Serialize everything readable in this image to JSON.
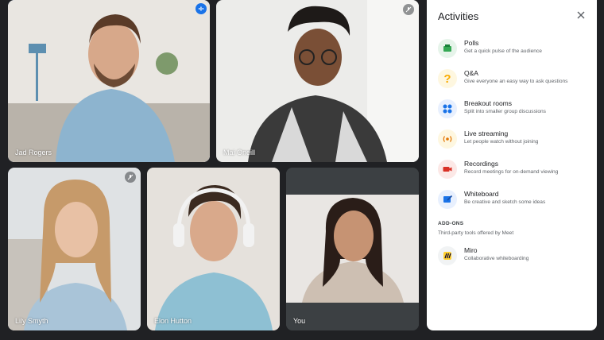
{
  "participants": [
    {
      "name": "Jad Rogers",
      "state": "speaking"
    },
    {
      "name": "Mai Oneill",
      "state": "muted"
    },
    {
      "name": "Lily Smyth",
      "state": "muted"
    },
    {
      "name": "Elon Hutton",
      "state": "none"
    },
    {
      "name": "You",
      "state": "none"
    }
  ],
  "panel": {
    "title": "Activities",
    "items": [
      {
        "title": "Polls",
        "description": "Get a quick pulse of the audience",
        "icon": "polls-icon"
      },
      {
        "title": "Q&A",
        "description": "Give everyone an easy way to ask questions",
        "icon": "question-icon"
      },
      {
        "title": "Breakout rooms",
        "description": "Split into smaller group discussions",
        "icon": "breakout-icon"
      },
      {
        "title": "Live streaming",
        "description": "Let people watch without joining",
        "icon": "live-stream-icon"
      },
      {
        "title": "Recordings",
        "description": "Record meetings for on-demand viewing",
        "icon": "recording-icon"
      },
      {
        "title": "Whiteboard",
        "description": "Be creative and sketch some ideas",
        "icon": "whiteboard-icon"
      }
    ],
    "addons_heading": "ADD-ONS",
    "addons_subheading": "Third-party tools offered by Meet",
    "addons": [
      {
        "title": "Miro",
        "description": "Collaborative whiteboarding",
        "icon": "miro-icon"
      }
    ]
  },
  "colors": {
    "background": "#202124",
    "active_outline": "#8ab4f8",
    "speaking_badge": "#1a73e8"
  }
}
